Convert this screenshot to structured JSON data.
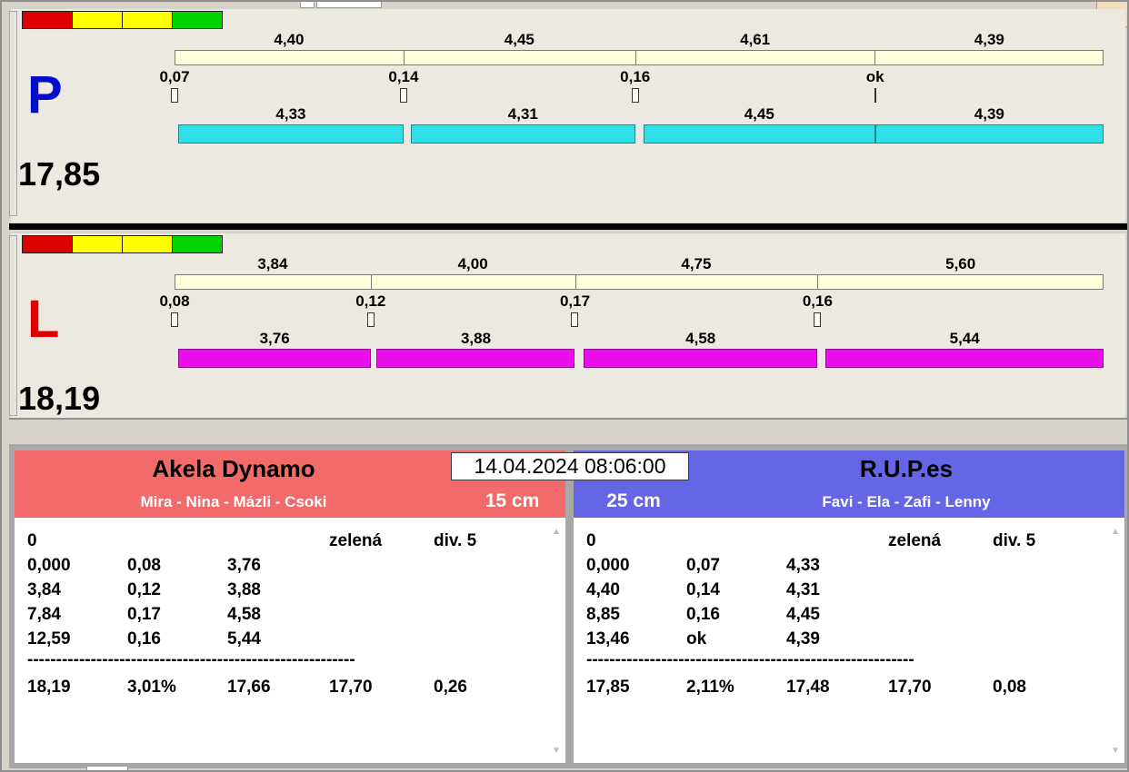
{
  "datetime": "14.04.2024 08:06:00",
  "icons": {
    "scroll_up": "▲",
    "scroll_down": "▼"
  },
  "separator": "---------------------------------------------------------",
  "lanes": [
    {
      "letter": "P",
      "letter_color": "#000ccc",
      "total_label": "17,85",
      "total": 17.85,
      "lights": [
        "#dd0000",
        "#ffff00",
        "#ffff00",
        "#00d400"
      ],
      "top_bar_color": "#ffffdc",
      "bottom_bar_color": "#2fe0e8",
      "top_segments": [
        {
          "label": "4,40",
          "value": 4.4
        },
        {
          "label": "4,45",
          "value": 4.45
        },
        {
          "label": "4,61",
          "value": 4.61
        },
        {
          "label": "4,39",
          "value": 4.39
        }
      ],
      "splits": [
        {
          "label": "0,07",
          "at": 0,
          "marker": "box"
        },
        {
          "label": "0,14",
          "at": 4.4,
          "marker": "box"
        },
        {
          "label": "0,16",
          "at": 8.85,
          "marker": "box"
        },
        {
          "label": "ok",
          "at": 13.46,
          "marker": "line"
        }
      ],
      "bottom_segments": [
        {
          "label": "4,33",
          "start": 0.07,
          "value": 4.33
        },
        {
          "label": "4,31",
          "start": 4.54,
          "value": 4.31
        },
        {
          "label": "4,45",
          "start": 9.01,
          "value": 4.45
        },
        {
          "label": "4,39",
          "start": 13.46,
          "value": 4.39
        }
      ]
    },
    {
      "letter": "L",
      "letter_color": "#e00000",
      "total_label": "18,19",
      "total": 18.19,
      "lights": [
        "#dd0000",
        "#ffff00",
        "#ffff00",
        "#00d400"
      ],
      "top_bar_color": "#ffffdc",
      "bottom_bar_color": "#ea0fea",
      "top_segments": [
        {
          "label": "3,84",
          "value": 3.84
        },
        {
          "label": "4,00",
          "value": 4.0
        },
        {
          "label": "4,75",
          "value": 4.75
        },
        {
          "label": "5,60",
          "value": 5.6
        }
      ],
      "splits": [
        {
          "label": "0,08",
          "at": 0,
          "marker": "box"
        },
        {
          "label": "0,12",
          "at": 3.84,
          "marker": "box"
        },
        {
          "label": "0,17",
          "at": 7.84,
          "marker": "box"
        },
        {
          "label": "0,16",
          "at": 12.59,
          "marker": "box"
        }
      ],
      "bottom_segments": [
        {
          "label": "3,76",
          "start": 0.08,
          "value": 3.76
        },
        {
          "label": "3,88",
          "start": 3.96,
          "value": 3.88
        },
        {
          "label": "4,58",
          "start": 8.01,
          "value": 4.58
        },
        {
          "label": "5,44",
          "start": 12.75,
          "value": 5.44
        }
      ]
    }
  ],
  "teams": [
    {
      "name": "Akela Dynamo",
      "dogs": "Mira - Nina - Mázli - Csoki",
      "height": "15 cm",
      "header_color": "#f26a6a",
      "first_row": {
        "col1": "0",
        "status": "zelená",
        "division": "div. 5"
      },
      "rows": [
        [
          "0,000",
          "0,08",
          "3,76"
        ],
        [
          "3,84",
          "0,12",
          "3,88"
        ],
        [
          "7,84",
          "0,17",
          "4,58"
        ],
        [
          "12,59",
          "0,16",
          "5,44"
        ]
      ],
      "summary": [
        "18,19",
        "3,01%",
        "17,66",
        "17,70",
        "0,26"
      ]
    },
    {
      "name": "R.U.P.es",
      "dogs": "Favi - Ela - Zafi - Lenny",
      "height": "25 cm",
      "header_color": "#6466e6",
      "first_row": {
        "col1": "0",
        "status": "zelená",
        "division": "div. 5"
      },
      "rows": [
        [
          "0,000",
          "0,07",
          "4,33"
        ],
        [
          "4,40",
          "0,14",
          "4,31"
        ],
        [
          "8,85",
          "0,16",
          "4,45"
        ],
        [
          "13,46",
          "ok",
          "4,39"
        ]
      ],
      "summary": [
        "17,85",
        "2,11%",
        "17,48",
        "17,70",
        "0,08"
      ]
    }
  ]
}
